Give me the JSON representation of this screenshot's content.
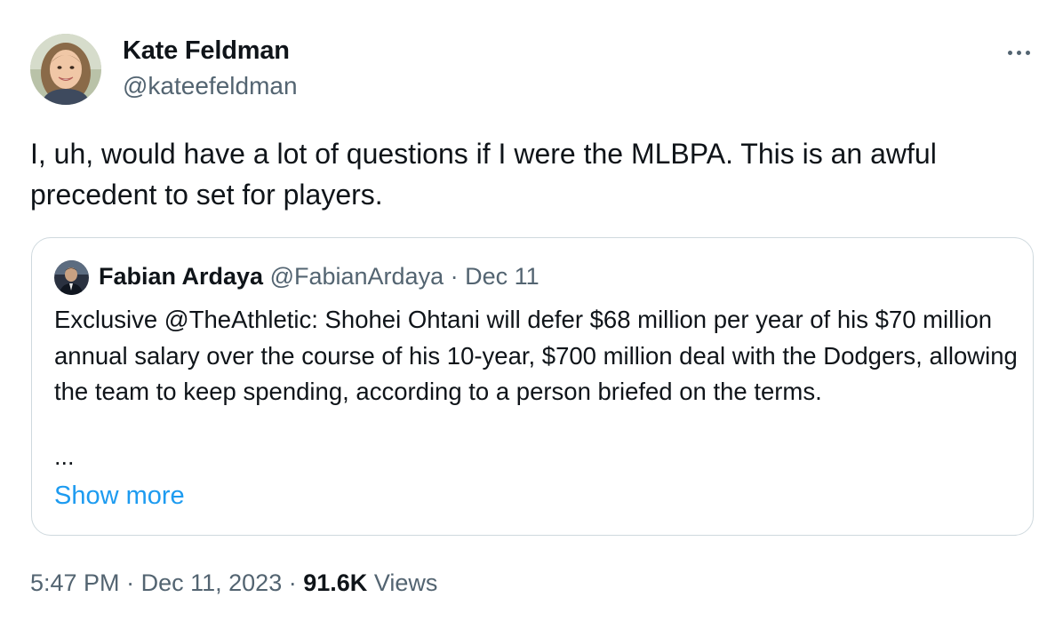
{
  "author": {
    "name": "Kate Feldman",
    "handle": "@kateefeldman",
    "avatar_icon": "person-photo-icon"
  },
  "tweet": {
    "text": "I, uh, would have a lot of questions if I were the MLBPA. This is an awful precedent to set for players."
  },
  "quote": {
    "author_name": "Fabian Ardaya",
    "handle": "@FabianArdaya",
    "separator": "·",
    "date": "Dec 11",
    "text": "Exclusive @TheAthletic: Shohei Ohtani will defer $68 million per year of his $70 million annual salary over the course of his 10-year, $700 million deal with the Dodgers, allowing the team to keep spending, according to a person briefed on the terms.",
    "ellipsis": "...",
    "show_more": "Show more"
  },
  "meta": {
    "time": "5:47 PM",
    "sep1": "·",
    "date": "Dec 11, 2023",
    "sep2": "·",
    "views_count": "91.6K",
    "views_label": "Views"
  },
  "colors": {
    "text_primary": "#0f1419",
    "text_secondary": "#536471",
    "link": "#1d9bf0",
    "border": "#cfd9de"
  }
}
